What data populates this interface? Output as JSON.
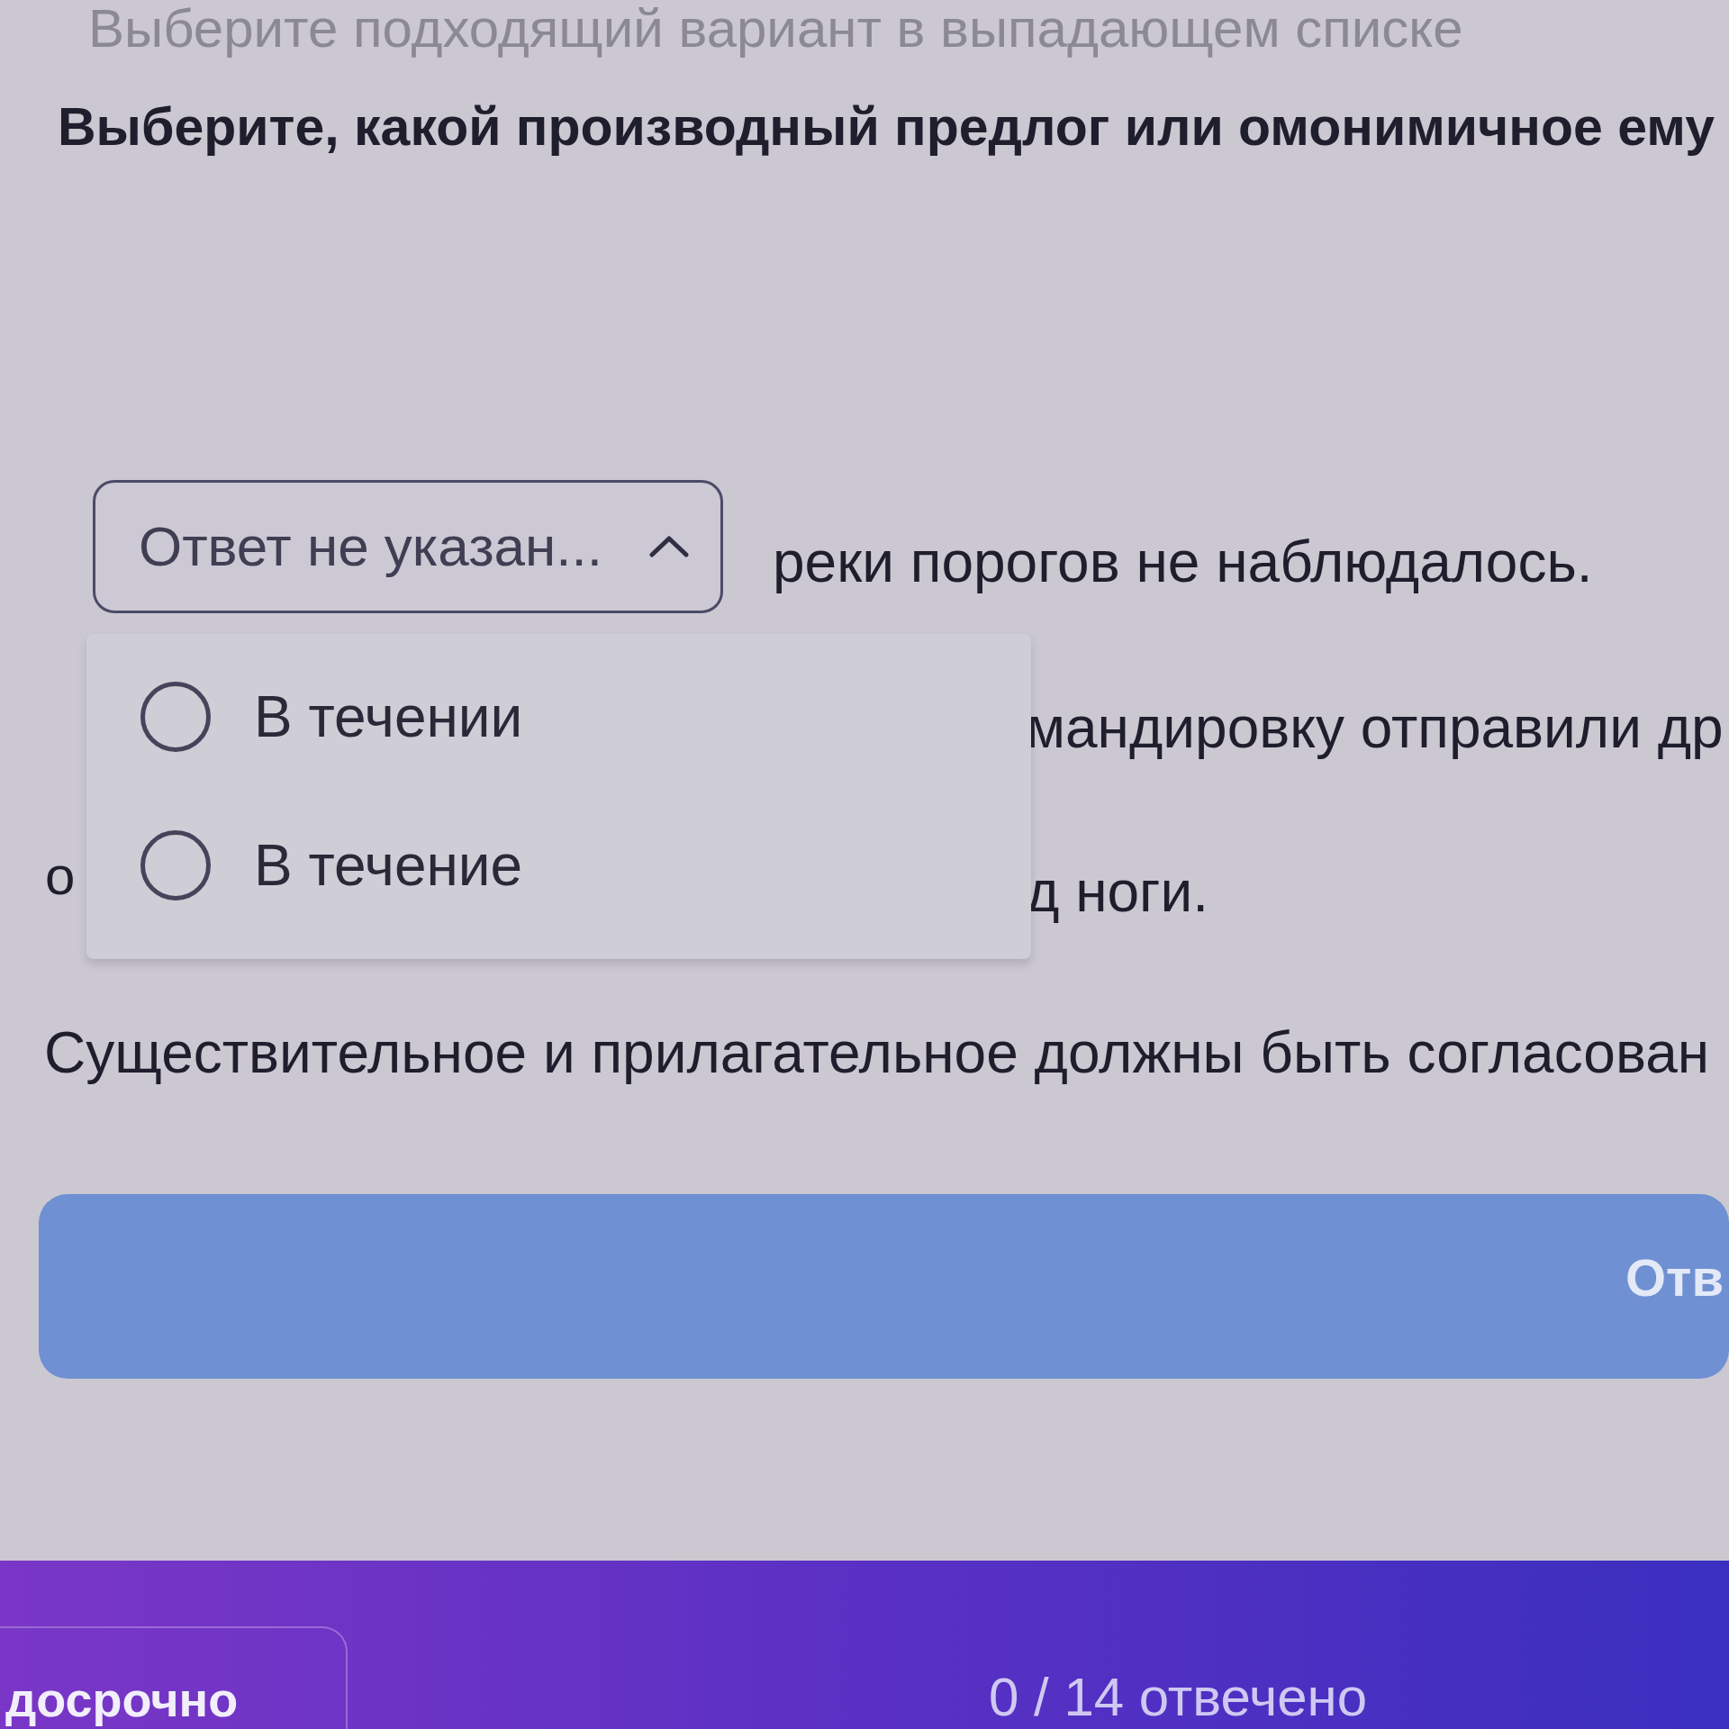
{
  "instruction": "Выберите подходящий вариант в выпадающем списке",
  "question": "Выберите, какой производный предлог или омонимичное ему",
  "select": {
    "value": "Ответ не указан...",
    "expanded": true,
    "options": [
      {
        "label": "В течении",
        "selected": false
      },
      {
        "label": "В течение",
        "selected": false
      }
    ]
  },
  "sentence_rest": "реки порогов не наблюдалось.",
  "line_2": {
    "right": "мандировку отправили др"
  },
  "line_3": {
    "left": "о",
    "right": "д ноги."
  },
  "hint": "Существительное и прилагательное должны быть согласован",
  "submit_button": "Отв",
  "footer": {
    "finish_button": "досрочно",
    "progress": "0 / 14 отвечено"
  }
}
